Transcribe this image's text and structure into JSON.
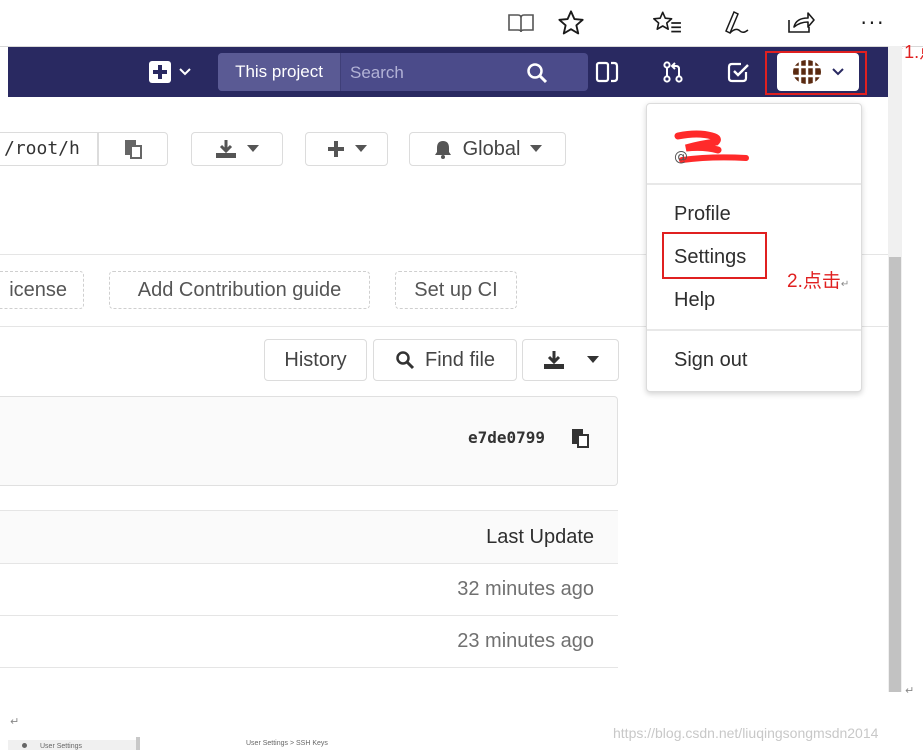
{
  "browser": {
    "icons": [
      "reading-view-icon",
      "favorite-star-icon",
      "favorites-list-icon",
      "pen-icon",
      "share-icon",
      "more-icon"
    ],
    "more_label": "···"
  },
  "navbar": {
    "bg_color": "#292961",
    "search": {
      "scope_label": "This project",
      "placeholder": "Search"
    },
    "annotation_1": "1.点"
  },
  "project": {
    "clone_url": "/root/h",
    "notification_label": "Global"
  },
  "quick_actions": {
    "license_label": "icense",
    "contribution_label": "Add Contribution guide",
    "ci_label": "Set up CI"
  },
  "tree": {
    "history_label": "History",
    "find_file_label": "Find file"
  },
  "commit": {
    "sha": "e7de0799"
  },
  "table": {
    "last_update_header": "Last Update",
    "rows": [
      {
        "last_update": "32 minutes ago"
      },
      {
        "last_update": "23 minutes ago"
      }
    ]
  },
  "user_menu": {
    "items": {
      "profile": "Profile",
      "settings": "Settings",
      "help": "Help",
      "sign_out": "Sign out"
    },
    "annotation_2": "2.点击",
    "username_prefix": "@"
  },
  "watermark": "https://blog.csdn.net/liuqingsongmsdn2014",
  "bottom_strip": {
    "left_text": "User Settings",
    "breadcrumb_text": "User Settings > SSH Keys"
  },
  "colors": {
    "annotation_red": "#e02020",
    "navbar_search_bg": "#4b4b8a"
  }
}
